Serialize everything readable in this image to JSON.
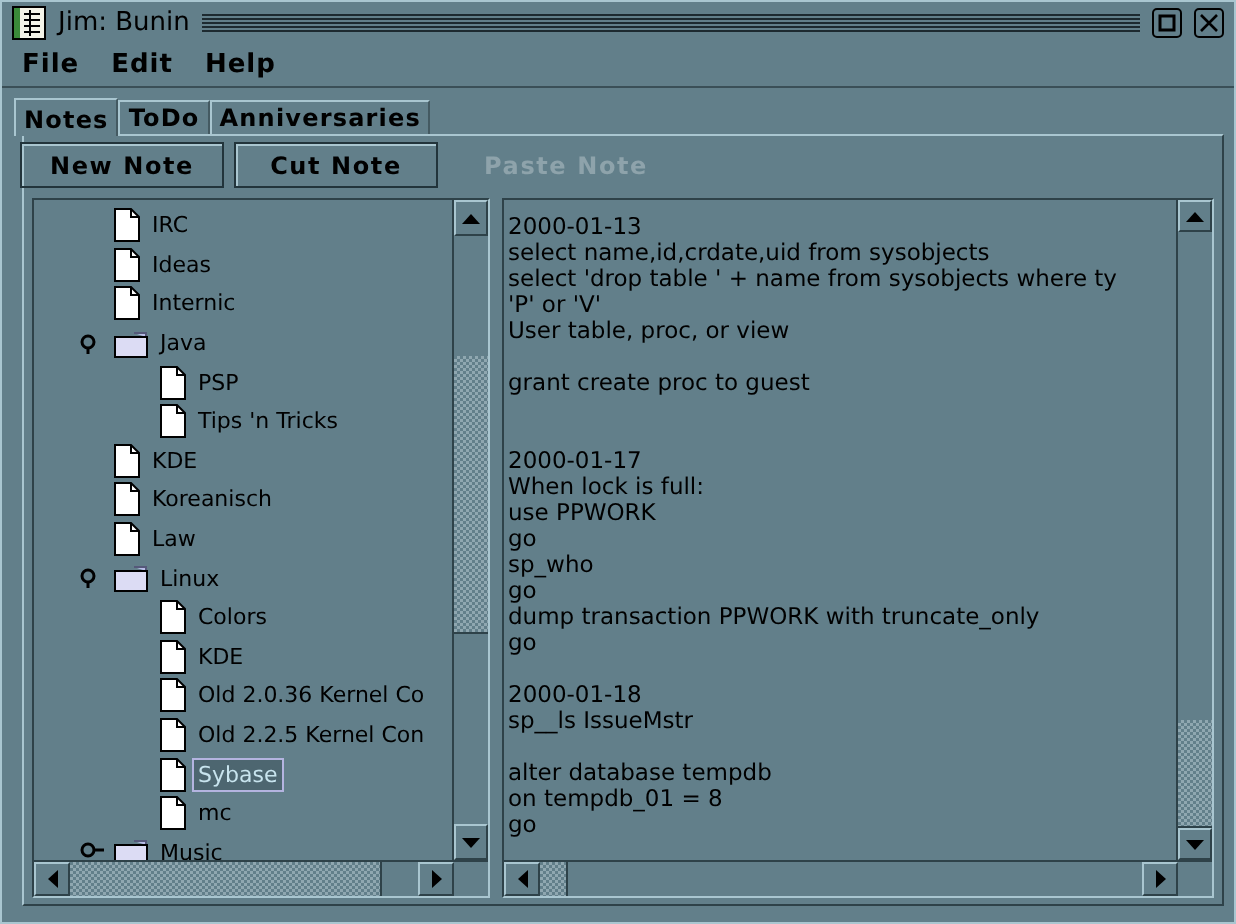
{
  "window": {
    "title": "Jim: Bunin"
  },
  "menu": [
    "File",
    "Edit",
    "Help"
  ],
  "tabs": [
    {
      "label": "Notes",
      "selected": true
    },
    {
      "label": "ToDo",
      "selected": false
    },
    {
      "label": "Anniversaries",
      "selected": false
    }
  ],
  "buttons": [
    {
      "label": "New Note",
      "disabled": false
    },
    {
      "label": "Cut Note",
      "disabled": false
    },
    {
      "label": "Paste Note",
      "disabled": true
    }
  ],
  "tree": [
    {
      "kind": "note",
      "label": "IRC",
      "selected": false
    },
    {
      "kind": "note",
      "label": "Ideas",
      "selected": false
    },
    {
      "kind": "note",
      "label": "Internic",
      "selected": false
    },
    {
      "kind": "folder",
      "label": "Java",
      "selected": false,
      "expanded": true,
      "children": [
        {
          "kind": "note",
          "label": "PSP",
          "selected": false
        },
        {
          "kind": "note",
          "label": "Tips 'n Tricks",
          "selected": false
        }
      ]
    },
    {
      "kind": "note",
      "label": "KDE",
      "selected": false
    },
    {
      "kind": "note",
      "label": "Koreanisch",
      "selected": false
    },
    {
      "kind": "note",
      "label": "Law",
      "selected": false
    },
    {
      "kind": "folder",
      "label": "Linux",
      "selected": false,
      "expanded": true,
      "children": [
        {
          "kind": "note",
          "label": "Colors",
          "selected": false
        },
        {
          "kind": "note",
          "label": "KDE",
          "selected": false
        },
        {
          "kind": "note",
          "label": "Old 2.0.36 Kernel Co",
          "selected": false
        },
        {
          "kind": "note",
          "label": "Old 2.2.5 Kernel Con",
          "selected": false
        },
        {
          "kind": "note",
          "label": "Sybase",
          "selected": true
        },
        {
          "kind": "note",
          "label": "mc",
          "selected": false
        }
      ]
    },
    {
      "kind": "folder",
      "label": "Music",
      "selected": false,
      "expanded": false
    }
  ],
  "note_text": "2000-01-13\nselect name,id,crdate,uid from sysobjects\nselect 'drop table ' + name from sysobjects where ty\n'P' or 'V'\nUser table, proc, or view\n\ngrant create proc to guest\n\n\n2000-01-17\nWhen lock is full:\nuse PPWORK\ngo\nsp_who\ngo\ndump transaction PPWORK with truncate_only\ngo\n\n2000-01-18\nsp__ls IssueMstr\n\nalter database tempdb\non tempdb_01 = 8\ngo"
}
